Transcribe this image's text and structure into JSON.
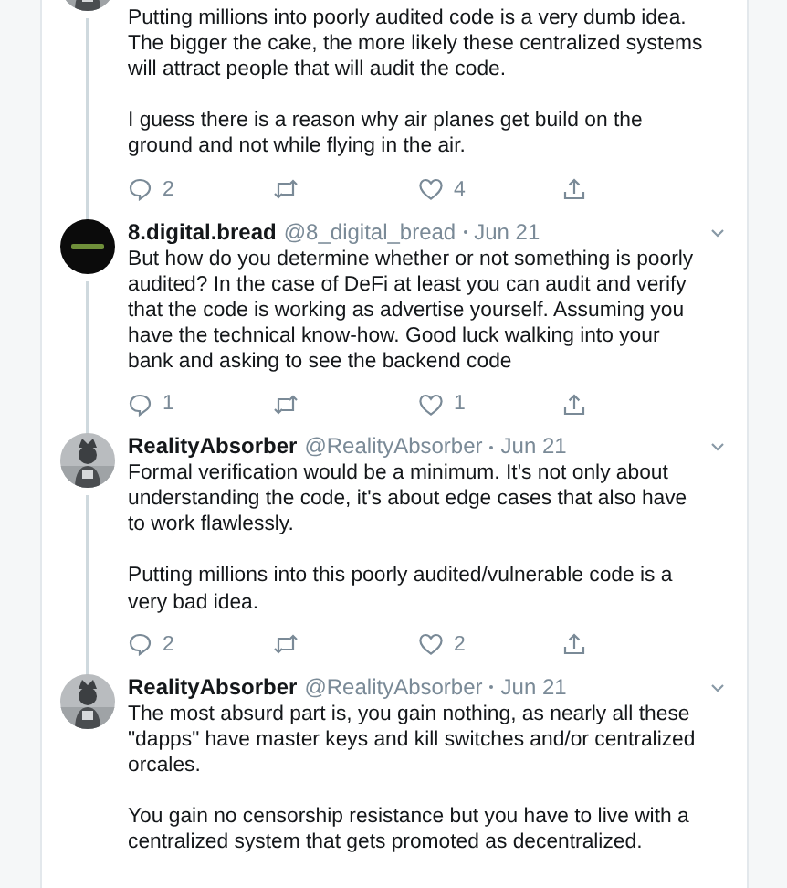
{
  "tweets": [
    {
      "body": [
        "Putting millions into poorly audited code is a very dumb idea. The bigger the cake, the more likely these centralized systems will attract people that will audit the code.",
        "I guess there is a reason why air planes get build on the ground and not while flying in the air."
      ],
      "actions": [
        {
          "kind": "reply",
          "count": "2"
        },
        {
          "kind": "retweet"
        },
        {
          "kind": "like",
          "count": "4"
        },
        {
          "kind": "share"
        }
      ]
    },
    {
      "avatar": {
        "kind": "logo"
      },
      "name": "8.digital.bread",
      "handle": "@8_digital_bread",
      "date": "Jun 21",
      "body": [
        "But how do you determine whether or not something is poorly audited? In the case of DeFi at least you can audit and verify that the code is working as advertise yourself. Assuming you have the technical know-how. Good luck walking into your bank and asking to see the backend code"
      ],
      "actions": [
        {
          "kind": "reply",
          "count": "1"
        },
        {
          "kind": "retweet"
        },
        {
          "kind": "like",
          "count": "1"
        },
        {
          "kind": "share"
        }
      ]
    },
    {
      "name": "RealityAbsorber",
      "handle": "@RealityAbsorber",
      "date": "Jun 21",
      "body": [
        "Formal verification would be a minimum. It's not only about understanding the code, it's about edge cases that also have to work flawlessly.",
        "Putting millions into this poorly audited/vulnerable code is a very bad idea."
      ],
      "actions": [
        {
          "kind": "reply",
          "count": "2"
        },
        {
          "kind": "retweet"
        },
        {
          "kind": "like",
          "count": "2"
        },
        {
          "kind": "share"
        }
      ]
    },
    {
      "name": "RealityAbsorber",
      "handle": "@RealityAbsorber",
      "date": "Jun 21",
      "body": [
        "The most absurd part is, you gain nothing, as nearly all these \"dapps\" have master keys and kill switches and/or centralized orcales.",
        "You gain no censorship resistance but you have to live with a centralized system that gets promoted as decentralized."
      ]
    }
  ]
}
